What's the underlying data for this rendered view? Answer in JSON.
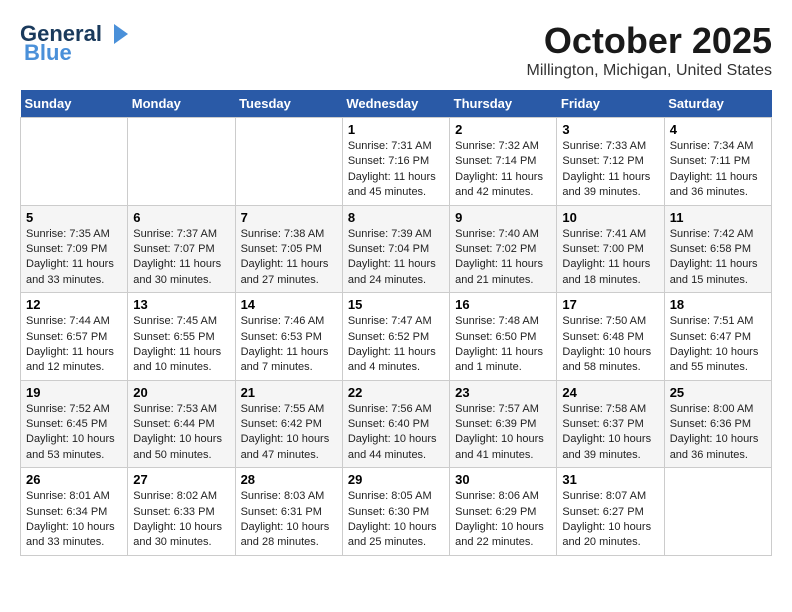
{
  "header": {
    "logo_main": "General",
    "logo_sub": "Blue",
    "month": "October 2025",
    "location": "Millington, Michigan, United States"
  },
  "days_of_week": [
    "Sunday",
    "Monday",
    "Tuesday",
    "Wednesday",
    "Thursday",
    "Friday",
    "Saturday"
  ],
  "weeks": [
    [
      {
        "day": "",
        "content": ""
      },
      {
        "day": "",
        "content": ""
      },
      {
        "day": "",
        "content": ""
      },
      {
        "day": "1",
        "content": "Sunrise: 7:31 AM\nSunset: 7:16 PM\nDaylight: 11 hours\nand 45 minutes."
      },
      {
        "day": "2",
        "content": "Sunrise: 7:32 AM\nSunset: 7:14 PM\nDaylight: 11 hours\nand 42 minutes."
      },
      {
        "day": "3",
        "content": "Sunrise: 7:33 AM\nSunset: 7:12 PM\nDaylight: 11 hours\nand 39 minutes."
      },
      {
        "day": "4",
        "content": "Sunrise: 7:34 AM\nSunset: 7:11 PM\nDaylight: 11 hours\nand 36 minutes."
      }
    ],
    [
      {
        "day": "5",
        "content": "Sunrise: 7:35 AM\nSunset: 7:09 PM\nDaylight: 11 hours\nand 33 minutes."
      },
      {
        "day": "6",
        "content": "Sunrise: 7:37 AM\nSunset: 7:07 PM\nDaylight: 11 hours\nand 30 minutes."
      },
      {
        "day": "7",
        "content": "Sunrise: 7:38 AM\nSunset: 7:05 PM\nDaylight: 11 hours\nand 27 minutes."
      },
      {
        "day": "8",
        "content": "Sunrise: 7:39 AM\nSunset: 7:04 PM\nDaylight: 11 hours\nand 24 minutes."
      },
      {
        "day": "9",
        "content": "Sunrise: 7:40 AM\nSunset: 7:02 PM\nDaylight: 11 hours\nand 21 minutes."
      },
      {
        "day": "10",
        "content": "Sunrise: 7:41 AM\nSunset: 7:00 PM\nDaylight: 11 hours\nand 18 minutes."
      },
      {
        "day": "11",
        "content": "Sunrise: 7:42 AM\nSunset: 6:58 PM\nDaylight: 11 hours\nand 15 minutes."
      }
    ],
    [
      {
        "day": "12",
        "content": "Sunrise: 7:44 AM\nSunset: 6:57 PM\nDaylight: 11 hours\nand 12 minutes."
      },
      {
        "day": "13",
        "content": "Sunrise: 7:45 AM\nSunset: 6:55 PM\nDaylight: 11 hours\nand 10 minutes."
      },
      {
        "day": "14",
        "content": "Sunrise: 7:46 AM\nSunset: 6:53 PM\nDaylight: 11 hours\nand 7 minutes."
      },
      {
        "day": "15",
        "content": "Sunrise: 7:47 AM\nSunset: 6:52 PM\nDaylight: 11 hours\nand 4 minutes."
      },
      {
        "day": "16",
        "content": "Sunrise: 7:48 AM\nSunset: 6:50 PM\nDaylight: 11 hours\nand 1 minute."
      },
      {
        "day": "17",
        "content": "Sunrise: 7:50 AM\nSunset: 6:48 PM\nDaylight: 10 hours\nand 58 minutes."
      },
      {
        "day": "18",
        "content": "Sunrise: 7:51 AM\nSunset: 6:47 PM\nDaylight: 10 hours\nand 55 minutes."
      }
    ],
    [
      {
        "day": "19",
        "content": "Sunrise: 7:52 AM\nSunset: 6:45 PM\nDaylight: 10 hours\nand 53 minutes."
      },
      {
        "day": "20",
        "content": "Sunrise: 7:53 AM\nSunset: 6:44 PM\nDaylight: 10 hours\nand 50 minutes."
      },
      {
        "day": "21",
        "content": "Sunrise: 7:55 AM\nSunset: 6:42 PM\nDaylight: 10 hours\nand 47 minutes."
      },
      {
        "day": "22",
        "content": "Sunrise: 7:56 AM\nSunset: 6:40 PM\nDaylight: 10 hours\nand 44 minutes."
      },
      {
        "day": "23",
        "content": "Sunrise: 7:57 AM\nSunset: 6:39 PM\nDaylight: 10 hours\nand 41 minutes."
      },
      {
        "day": "24",
        "content": "Sunrise: 7:58 AM\nSunset: 6:37 PM\nDaylight: 10 hours\nand 39 minutes."
      },
      {
        "day": "25",
        "content": "Sunrise: 8:00 AM\nSunset: 6:36 PM\nDaylight: 10 hours\nand 36 minutes."
      }
    ],
    [
      {
        "day": "26",
        "content": "Sunrise: 8:01 AM\nSunset: 6:34 PM\nDaylight: 10 hours\nand 33 minutes."
      },
      {
        "day": "27",
        "content": "Sunrise: 8:02 AM\nSunset: 6:33 PM\nDaylight: 10 hours\nand 30 minutes."
      },
      {
        "day": "28",
        "content": "Sunrise: 8:03 AM\nSunset: 6:31 PM\nDaylight: 10 hours\nand 28 minutes."
      },
      {
        "day": "29",
        "content": "Sunrise: 8:05 AM\nSunset: 6:30 PM\nDaylight: 10 hours\nand 25 minutes."
      },
      {
        "day": "30",
        "content": "Sunrise: 8:06 AM\nSunset: 6:29 PM\nDaylight: 10 hours\nand 22 minutes."
      },
      {
        "day": "31",
        "content": "Sunrise: 8:07 AM\nSunset: 6:27 PM\nDaylight: 10 hours\nand 20 minutes."
      },
      {
        "day": "",
        "content": ""
      }
    ]
  ]
}
